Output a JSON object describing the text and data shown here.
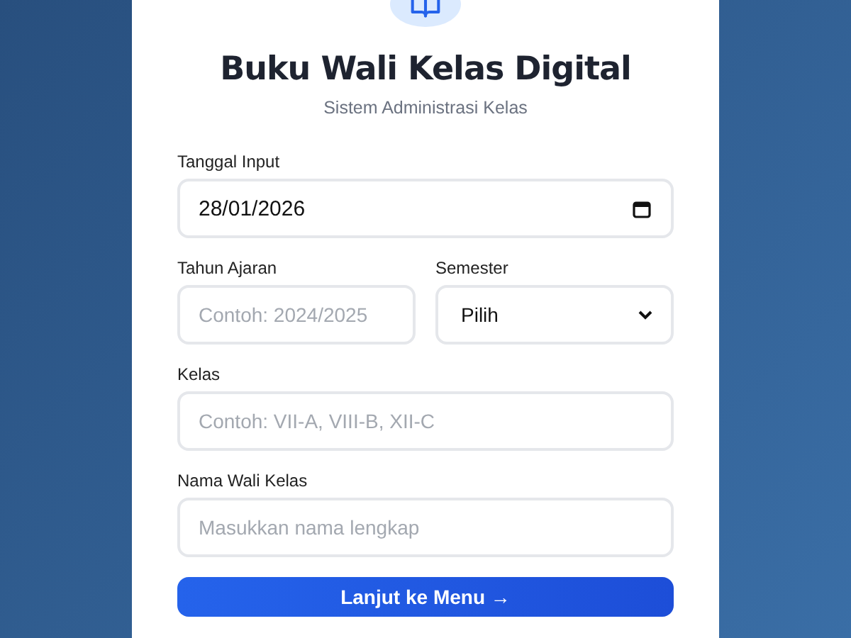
{
  "header": {
    "title": "Buku Wali Kelas Digital",
    "subtitle": "Sistem Administrasi Kelas"
  },
  "fields": [
    {
      "kind": "date",
      "label": "Tanggal Input",
      "value": "28/01/2026"
    },
    {
      "kind": "row",
      "items": [
        {
          "kind": "text",
          "label": "Tahun Ajaran",
          "placeholder": "Contoh: 2024/2025"
        },
        {
          "kind": "select",
          "label": "Semester",
          "value": "Pilih"
        }
      ]
    },
    {
      "kind": "text",
      "label": "Kelas",
      "placeholder": "Contoh: VII-A, VIII-B, XII-C"
    },
    {
      "kind": "text",
      "label": "Nama Wali Kelas",
      "placeholder": "Masukkan nama lengkap"
    }
  ],
  "submit_button": "Lanjut ke Menu →"
}
